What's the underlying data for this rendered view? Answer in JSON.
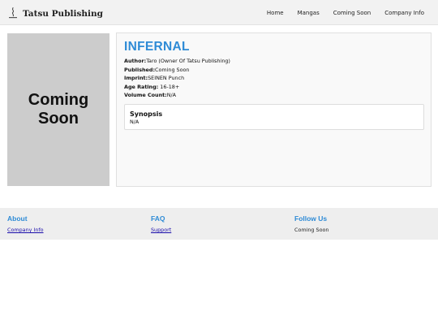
{
  "header": {
    "brand": "Tatsu Publishing",
    "nav": [
      "Home",
      "Mangas",
      "Coming Soon",
      "Company Info"
    ]
  },
  "cover": {
    "placeholder": "Coming Soon"
  },
  "manga": {
    "title": "INFERNAL",
    "author_label": "Author:",
    "author": "Taro (Owner Of Tatsu Publishing)",
    "published_label": "Published:",
    "published": "Coming Soon",
    "imprint_label": "Imprint:",
    "imprint": "SEINEN Punch",
    "age_label": "Age Rating:",
    "age": "16-18+",
    "volume_label": "Volume Count:",
    "volume": "N/A",
    "synopsis_heading": "Synopsis",
    "synopsis": "N/A"
  },
  "footer": {
    "about_heading": "About",
    "about_link": "Company Info",
    "faq_heading": "FAQ",
    "faq_link": "Support",
    "follow_heading": "Follow Us",
    "follow_text": "Coming Soon"
  },
  "colors": {
    "accent": "#2e8bd6",
    "link": "#1a0dab"
  }
}
